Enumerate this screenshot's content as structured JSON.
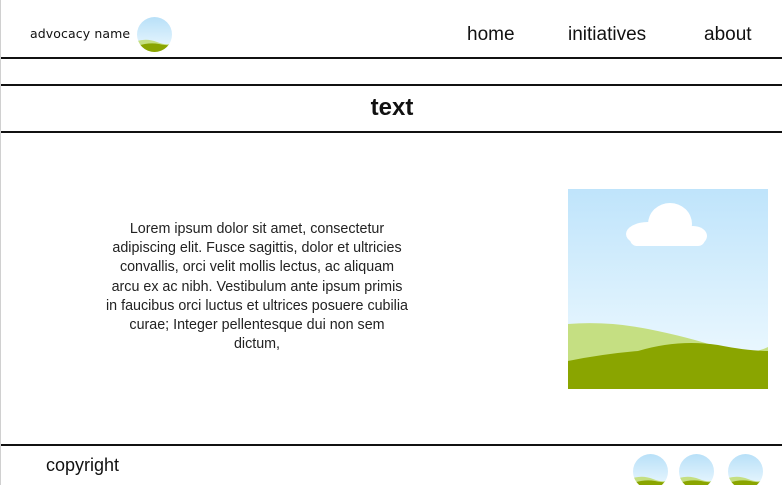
{
  "header": {
    "brand": "advocacy name",
    "logo_icon": "landscape-circle-icon",
    "nav": [
      {
        "label": "home"
      },
      {
        "label": "initiatives"
      },
      {
        "label": "about"
      }
    ]
  },
  "main": {
    "heading": "text",
    "paragraph": "Lorem ipsum dolor sit amet, consectetur adipiscing elit. Fusce sagittis, dolor et ultricies convallis, orci velit mollis lectus, ac aliquam arcu ex ac nibh. Vestibulum ante ipsum primis in faucibus orci luctus et ultrices posuere cubilia curae; Integer pellentesque dui non sem dictum,",
    "image_icon": "landscape-image-icon"
  },
  "footer": {
    "copyright": "copyright",
    "social_icons": [
      "landscape-circle-icon",
      "landscape-circle-icon",
      "landscape-circle-icon"
    ]
  },
  "colors": {
    "sky_top": "#bfe4fb",
    "sky_bottom": "#eef9ff",
    "hill_light": "#c5df82",
    "hill_dark": "#8aa500",
    "line": "#111111"
  }
}
